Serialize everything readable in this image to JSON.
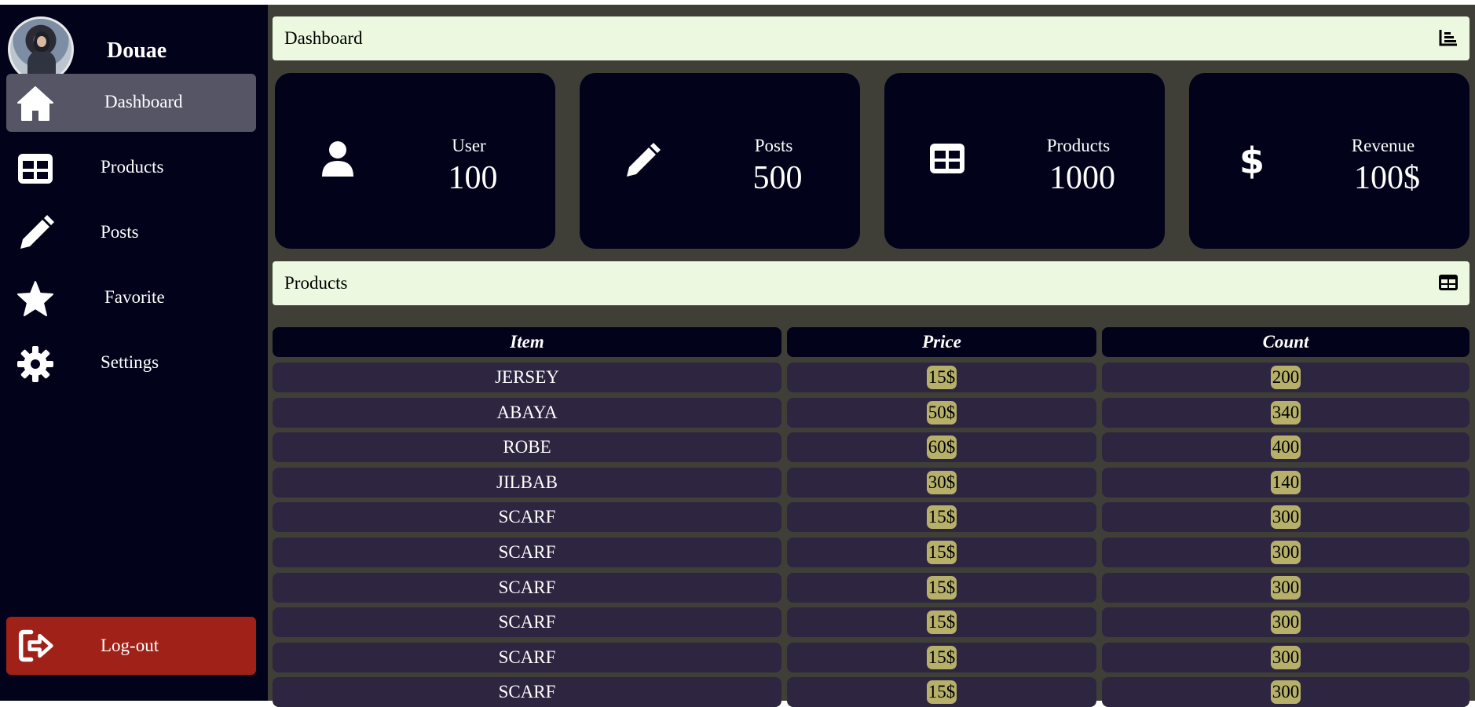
{
  "sidebar": {
    "username": "Douae",
    "nav": [
      {
        "label": "Dashboard",
        "icon": "home-icon",
        "active": true
      },
      {
        "label": "Products",
        "icon": "table-icon",
        "active": false
      },
      {
        "label": "Posts",
        "icon": "pencil-icon",
        "active": false
      },
      {
        "label": "Favorite",
        "icon": "star-icon",
        "active": false
      },
      {
        "label": "Settings",
        "icon": "gear-icon",
        "active": false
      }
    ],
    "logout": {
      "label": "Log-out",
      "icon": "logout-icon"
    }
  },
  "dashboard_bar": {
    "title": "Dashboard",
    "icon": "chart-icon"
  },
  "stats": [
    {
      "label": "User",
      "value": "100",
      "icon": "user-icon"
    },
    {
      "label": "Posts",
      "value": "500",
      "icon": "pencil-icon"
    },
    {
      "label": "Products",
      "value": "1000",
      "icon": "table-icon"
    },
    {
      "label": "Revenue",
      "value": "100$",
      "icon": "dollar-icon"
    }
  ],
  "products_bar": {
    "title": "Products",
    "icon": "table-icon"
  },
  "table": {
    "headers": {
      "item": "Item",
      "price": "Price",
      "count": "Count"
    },
    "rows": [
      {
        "item": "JERSEY",
        "price": "15$",
        "count": "200"
      },
      {
        "item": "ABAYA",
        "price": "50$",
        "count": "340"
      },
      {
        "item": "ROBE",
        "price": "60$",
        "count": "400"
      },
      {
        "item": "JILBAB",
        "price": "30$",
        "count": "140"
      },
      {
        "item": "SCARF",
        "price": "15$",
        "count": "300"
      },
      {
        "item": "SCARF",
        "price": "15$",
        "count": "300"
      },
      {
        "item": "SCARF",
        "price": "15$",
        "count": "300"
      },
      {
        "item": "SCARF",
        "price": "15$",
        "count": "300"
      },
      {
        "item": "SCARF",
        "price": "15$",
        "count": "300"
      },
      {
        "item": "SCARF",
        "price": "15$",
        "count": "300"
      }
    ]
  },
  "colors": {
    "sidebar_bg": "#02021a",
    "main_bg": "#3f3f38",
    "active_nav": "#555566",
    "logout_bg": "#a02118",
    "bar_bg": "#ecf9e0",
    "row_bg": "#2e2540",
    "pill_bg": "#b6b06a"
  }
}
